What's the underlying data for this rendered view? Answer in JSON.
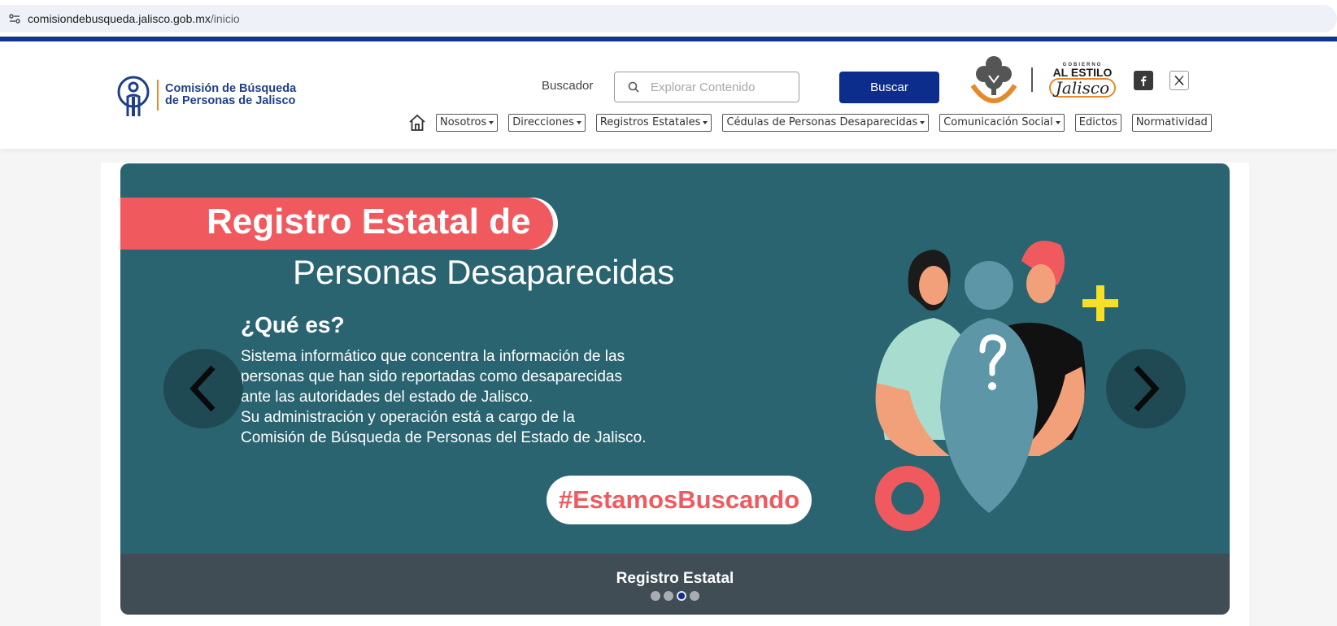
{
  "browser": {
    "url_host": "comisiondebusqueda.jalisco.gob.mx",
    "url_path": "/inicio"
  },
  "header": {
    "logo_line1": "Comisión de Búsqueda",
    "logo_line2": "de Personas de Jalisco",
    "search_label": "Buscador",
    "search_placeholder": "Explorar Contenido",
    "search_button": "Buscar",
    "gov_small": "GOBIERNO",
    "gov_big": "AL ESTILO",
    "gov_jalisco": "Jalisco"
  },
  "nav": {
    "items": [
      {
        "label": "Nosotros",
        "dropdown": true
      },
      {
        "label": "Direcciones",
        "dropdown": true
      },
      {
        "label": "Registros Estatales",
        "dropdown": true
      },
      {
        "label": "Cédulas de Personas Desaparecidas",
        "dropdown": true
      },
      {
        "label": "Comunicación Social",
        "dropdown": true
      },
      {
        "label": "Edictos",
        "dropdown": false
      },
      {
        "label": "Normatividad",
        "dropdown": false
      }
    ]
  },
  "carousel": {
    "banner_title": "Registro Estatal de",
    "banner_subtitle": "Personas Desaparecidas",
    "question": "¿Qué es?",
    "body_lines": [
      "Sistema informático que concentra la información de las",
      "personas que han sido reportadas como desaparecidas",
      "ante las autoridades del estado de Jalisco.",
      "Su administración y operación está a cargo de la",
      "Comisión de Búsqueda de Personas del Estado de Jalisco."
    ],
    "hashtag": "#EstamosBuscando",
    "caption": "Registro Estatal",
    "slide_count": 4,
    "active_index": 2
  },
  "colors": {
    "brand_blue": "#0d2d8c",
    "slide_bg": "#2a6470",
    "accent_red": "#f05a5f",
    "caption_bg": "#404d55"
  }
}
